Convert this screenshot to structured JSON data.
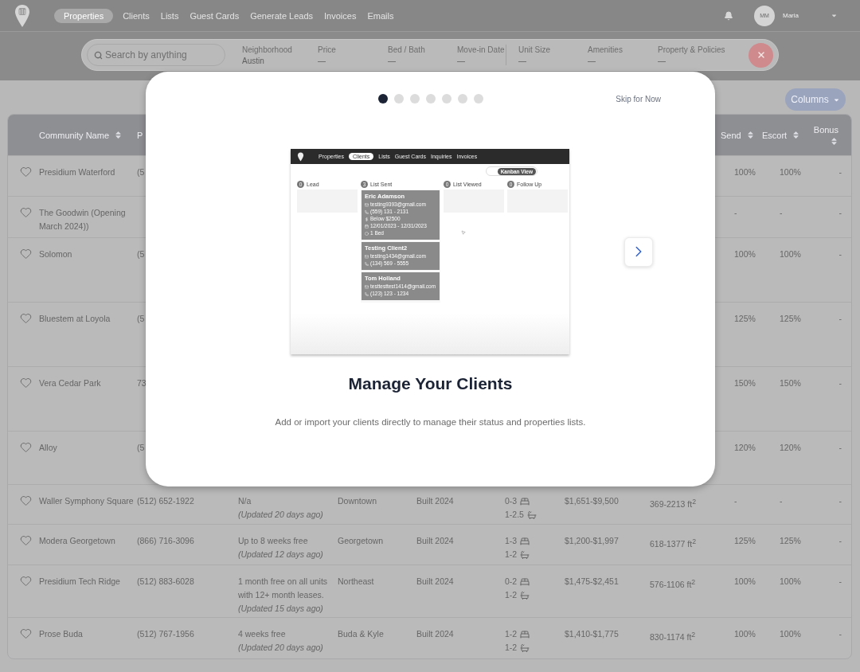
{
  "nav": {
    "items": [
      {
        "label": "Properties",
        "selected": true
      },
      {
        "label": "Clients",
        "selected": false
      },
      {
        "label": "Lists",
        "selected": false
      },
      {
        "label": "Guest Cards",
        "selected": false
      },
      {
        "label": "Generate Leads",
        "selected": false
      },
      {
        "label": "Invoices",
        "selected": false
      },
      {
        "label": "Emails",
        "selected": false
      }
    ]
  },
  "user": {
    "initials": "MM",
    "name": "Maria"
  },
  "search": {
    "placeholder": "Search by anything"
  },
  "filters": [
    {
      "label": "Neighborhood",
      "value": "Austin",
      "divider_before": false
    },
    {
      "label": "Price",
      "value": "—",
      "divider_before": false
    },
    {
      "label": "Bed / Bath",
      "value": "—",
      "divider_before": false
    },
    {
      "label": "Move-in Date",
      "value": "—",
      "divider_before": false
    },
    {
      "label": "Unit Size",
      "value": "—",
      "divider_before": true
    },
    {
      "label": "Amenities",
      "value": "—",
      "divider_before": false
    },
    {
      "label": "Property & Policies",
      "value": "—",
      "divider_before": false
    }
  ],
  "columns_button": "Columns",
  "table": {
    "columns": [
      {
        "label": "Community Name",
        "sortable": true
      },
      {
        "label": "P"
      },
      {
        "label": "Send",
        "sortable": true
      },
      {
        "label": "Escort",
        "sortable": true
      },
      {
        "label": "Bonus",
        "sortable": true
      }
    ],
    "rows": [
      {
        "name": "Presidium Waterford",
        "phone": "(5",
        "send": "100%",
        "escort": "100%",
        "bonus": "-"
      },
      {
        "name": "The Goodwin (Opening March 2024))",
        "send": "-",
        "escort": "-",
        "bonus": "-"
      },
      {
        "name": "Solomon",
        "phone": "(5",
        "send": "100%",
        "escort": "100%",
        "bonus": "-"
      },
      {
        "name": "Bluestem at Loyola",
        "phone": "(5",
        "send": "125%",
        "escort": "125%",
        "bonus": "-"
      },
      {
        "name": "Vera Cedar Park",
        "phone": "73",
        "send": "150%",
        "escort": "150%",
        "bonus": "-"
      },
      {
        "name": "Alloy",
        "phone": "(5",
        "send": "120%",
        "escort": "120%",
        "bonus": "-"
      },
      {
        "name": "Waller Symphony Square",
        "phone": "(512) 652-1922",
        "concession": "N/a",
        "updated": "(Updated 20 days ago)",
        "neighborhood": "Downtown",
        "built": "Built 2024",
        "beds": "0-3",
        "baths": "1-2.5",
        "price": "$1,651-$9,500",
        "size": "369-2213 ft$^{2}$",
        "send": "-",
        "escort": "-",
        "bonus": "-"
      },
      {
        "name": "Modera Georgetown",
        "phone": "(866) 716-3096",
        "concession": "Up to 8 weeks free",
        "updated": "(Updated 12 days ago)",
        "neighborhood": "Georgetown",
        "built": "Built 2024",
        "beds": "1-3",
        "baths": "1-2",
        "price": "$1,200-$1,997",
        "size": "618-1377 ft$^{2}$",
        "send": "125%",
        "escort": "125%",
        "bonus": "-"
      },
      {
        "name": "Presidium Tech Ridge",
        "phone": "(512) 883-6028",
        "concession": "1 month free on all units with 12+ month leases.",
        "updated": "(Updated 15 days ago)",
        "neighborhood": "Northeast",
        "built": "Built 2024",
        "beds": "0-2",
        "baths": "1-2",
        "price": "$1,475-$2,451",
        "size": "576-1106 ft$^{2}$",
        "send": "100%",
        "escort": "100%",
        "bonus": "-"
      },
      {
        "name": "Prose Buda",
        "phone": "(512) 767-1956",
        "concession": "4 weeks free",
        "updated": "(Updated 20 days ago)",
        "neighborhood": "Buda & Kyle",
        "built": "Built 2024",
        "beds": "1-2",
        "baths": "1-2",
        "price": "$1,410-$1,775",
        "size": "830-1174 ft$^{2}$",
        "send": "100%",
        "escort": "100%",
        "bonus": "-"
      }
    ]
  },
  "modal": {
    "steps": [
      {
        "selected": true
      },
      {
        "selected": false
      },
      {
        "selected": false
      },
      {
        "selected": false
      },
      {
        "selected": false
      },
      {
        "selected": false
      },
      {
        "selected": false
      }
    ],
    "skip": "Skip for Now",
    "title": "Manage Your Clients",
    "description": "Add or import your clients directly to manage their status and properties lists.",
    "preview": {
      "nav": [
        {
          "label": "Properties",
          "selected": false
        },
        {
          "label": "Clients",
          "selected": true
        },
        {
          "label": "Lists",
          "selected": false
        },
        {
          "label": "Guest Cards",
          "selected": false
        },
        {
          "label": "Inquiries",
          "selected": false
        },
        {
          "label": "Invoices",
          "selected": false
        }
      ],
      "toggle": "Kanban View",
      "columns": [
        {
          "title": "Lead",
          "count": "0"
        },
        {
          "title": "List Sent",
          "count": "3",
          "cards": [
            {
              "name": "Eric Adamson",
              "details": [
                {
                  "kind": "email",
                  "text": "testing9393@gmail.com"
                },
                {
                  "kind": "phone",
                  "text": "(559) 131 - 2131"
                },
                {
                  "kind": "budget",
                  "text": "Below $2500"
                },
                {
                  "kind": "dates",
                  "text": "12/01/2023 - 12/31/2023"
                },
                {
                  "kind": "beds",
                  "text": "1 Bed"
                }
              ]
            },
            {
              "name": "Testing Client2",
              "details": [
                {
                  "kind": "email",
                  "text": "testing1434@gmail.com"
                },
                {
                  "kind": "phone",
                  "text": "(134) 569 - 5555"
                }
              ]
            },
            {
              "name": "Tom Holland",
              "details": [
                {
                  "kind": "email",
                  "text": "testtesttest1414@gmail.com"
                },
                {
                  "kind": "phone",
                  "text": "(123) 123 - 1234"
                }
              ]
            }
          ]
        },
        {
          "title": "List Viewed",
          "count": "0"
        },
        {
          "title": "Follow Up",
          "count": "0"
        }
      ]
    }
  }
}
